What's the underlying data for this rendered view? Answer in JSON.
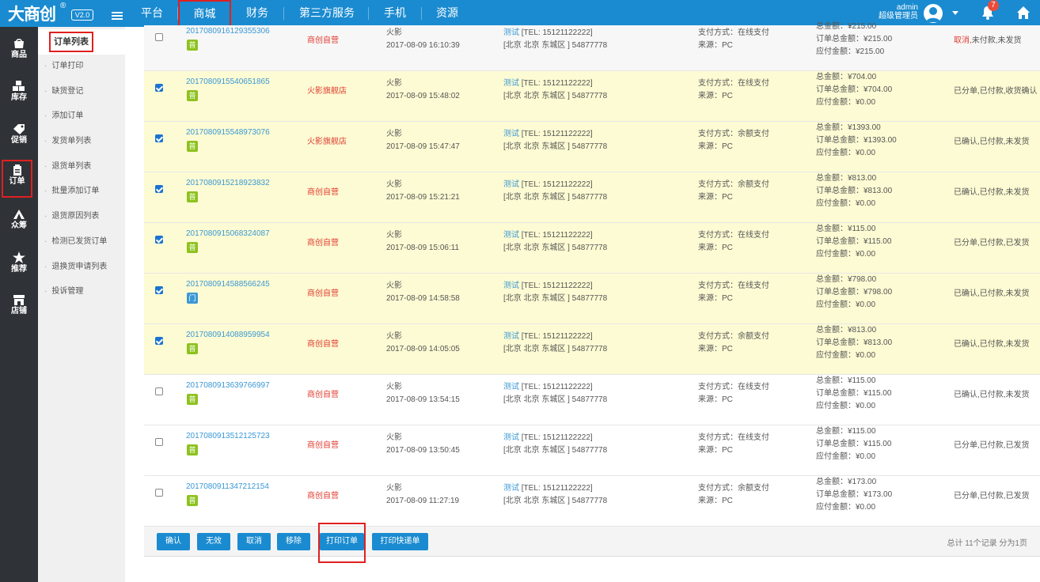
{
  "brand": {
    "logo": "大商创",
    "reg": "®",
    "version": "V2.0"
  },
  "nav": [
    "平台",
    "商城",
    "财务",
    "第三方服务",
    "手机",
    "资源"
  ],
  "user": {
    "name": "admin",
    "role": "超级管理员",
    "notifications": "7"
  },
  "sidebar": [
    "商品",
    "库存",
    "促销",
    "订单",
    "众筹",
    "推荐",
    "店铺"
  ],
  "submenu": {
    "title": "订单列表",
    "items": [
      "订单打印",
      "缺货登记",
      "添加订单",
      "发货单列表",
      "退货单列表",
      "批量添加订单",
      "退货原因列表",
      "检测已发货订单",
      "退换货申请列表",
      "投诉管理"
    ]
  },
  "orders": [
    {
      "no": "2017080916129355306",
      "tag": "普",
      "shop": "商创自营",
      "buyer": "火影",
      "time": "2017-08-09 16:10:39",
      "recv_name": "测试",
      "recv_tel": "[TEL: 15121122222]",
      "recv_addr": "[北京 北京 东城区 ] 54877778",
      "pay": "支付方式：在线支付",
      "src": "来源：PC",
      "total": "总金额：¥215.00",
      "order_total": "订单总金额：¥215.00",
      "due": "应付金额：¥215.00",
      "status_red": "取消,",
      "status": "未付款,未发货"
    },
    {
      "no": "2017080915540651865",
      "tag": "普",
      "shop": "火影旗舰店",
      "buyer": "火影",
      "time": "2017-08-09 15:48:02",
      "recv_name": "测试",
      "recv_tel": "[TEL: 15121122222]",
      "recv_addr": "[北京 北京 东城区 ] 54877778",
      "pay": "支付方式：在线支付",
      "src": "来源：PC",
      "total": "总金额：¥704.00",
      "order_total": "订单总金额：¥704.00",
      "due": "应付金额：¥0.00",
      "status_red": "",
      "status": "已分单,已付款,收货确认"
    },
    {
      "no": "2017080915548973076",
      "tag": "普",
      "shop": "火影旗舰店",
      "buyer": "火影",
      "time": "2017-08-09 15:47:47",
      "recv_name": "测试",
      "recv_tel": "[TEL: 15121122222]",
      "recv_addr": "[北京 北京 东城区 ] 54877778",
      "pay": "支付方式：余额支付",
      "src": "来源：PC",
      "total": "总金额：¥1393.00",
      "order_total": "订单总金额：¥1393.00",
      "due": "应付金额：¥0.00",
      "status_red": "",
      "status": "已确认,已付款,未发货"
    },
    {
      "no": "2017080915218923832",
      "tag": "普",
      "shop": "商创自营",
      "buyer": "火影",
      "time": "2017-08-09 15:21:21",
      "recv_name": "测试",
      "recv_tel": "[TEL: 15121122222]",
      "recv_addr": "[北京 北京 东城区 ] 54877778",
      "pay": "支付方式：余额支付",
      "src": "来源：PC",
      "total": "总金额：¥813.00",
      "order_total": "订单总金额：¥813.00",
      "due": "应付金额：¥0.00",
      "status_red": "",
      "status": "已确认,已付款,未发货"
    },
    {
      "no": "2017080915068324087",
      "tag": "普",
      "shop": "商创自营",
      "buyer": "火影",
      "time": "2017-08-09 15:06:11",
      "recv_name": "测试",
      "recv_tel": "[TEL: 15121122222]",
      "recv_addr": "[北京 北京 东城区 ] 54877778",
      "pay": "支付方式：在线支付",
      "src": "来源：PC",
      "total": "总金额：¥115.00",
      "order_total": "订单总金额：¥115.00",
      "due": "应付金额：¥0.00",
      "status_red": "",
      "status": "已分单,已付款,已发货"
    },
    {
      "no": "2017080914588566245",
      "tag": "门",
      "shop": "商创自营",
      "buyer": "火影",
      "time": "2017-08-09 14:58:58",
      "recv_name": "测试",
      "recv_tel": "[TEL: 15121122222]",
      "recv_addr": "[北京 北京 东城区 ] 54877778",
      "pay": "支付方式：在线支付",
      "src": "来源：PC",
      "total": "总金额：¥798.00",
      "order_total": "订单总金额：¥798.00",
      "due": "应付金额：¥0.00",
      "status_red": "",
      "status": "已确认,已付款,未发货"
    },
    {
      "no": "2017080914088959954",
      "tag": "普",
      "shop": "商创自营",
      "buyer": "火影",
      "time": "2017-08-09 14:05:05",
      "recv_name": "测试",
      "recv_tel": "[TEL: 15121122222]",
      "recv_addr": "[北京 北京 东城区 ] 54877778",
      "pay": "支付方式：余额支付",
      "src": "来源：PC",
      "total": "总金额：¥813.00",
      "order_total": "订单总金额：¥813.00",
      "due": "应付金额：¥0.00",
      "status_red": "",
      "status": "已确认,已付款,未发货"
    },
    {
      "no": "2017080913639766997",
      "tag": "普",
      "shop": "商创自营",
      "buyer": "火影",
      "time": "2017-08-09 13:54:15",
      "recv_name": "测试",
      "recv_tel": "[TEL: 15121122222]",
      "recv_addr": "[北京 北京 东城区 ] 54877778",
      "pay": "支付方式：在线支付",
      "src": "来源：PC",
      "total": "总金额：¥115.00",
      "order_total": "订单总金额：¥115.00",
      "due": "应付金额：¥0.00",
      "status_red": "",
      "status": "已确认,已付款,未发货"
    },
    {
      "no": "2017080913512125723",
      "tag": "普",
      "shop": "商创自营",
      "buyer": "火影",
      "time": "2017-08-09 13:50:45",
      "recv_name": "测试",
      "recv_tel": "[TEL: 15121122222]",
      "recv_addr": "[北京 北京 东城区 ] 54877778",
      "pay": "支付方式：在线支付",
      "src": "来源：PC",
      "total": "总金额：¥115.00",
      "order_total": "订单总金额：¥115.00",
      "due": "应付金额：¥0.00",
      "status_red": "",
      "status": "已分单,已付款,已发货"
    },
    {
      "no": "2017080911347212154",
      "tag": "普",
      "shop": "商创自营",
      "buyer": "火影",
      "time": "2017-08-09 11:27:19",
      "recv_name": "测试",
      "recv_tel": "[TEL: 15121122222]",
      "recv_addr": "[北京 北京 东城区 ] 54877778",
      "pay": "支付方式：余额支付",
      "src": "来源：PC",
      "total": "总金额：¥173.00",
      "order_total": "订单总金额：¥173.00",
      "due": "应付金额：¥0.00",
      "status_red": "",
      "status": "已分单,已付款,已发货"
    }
  ],
  "buttons": {
    "confirm": "确认",
    "invalid": "无效",
    "cancel": "取消",
    "remove": "移除",
    "print_order": "打印订单",
    "print_express": "打印快递单"
  },
  "pager": "总计 11个记录 分为1页",
  "colors": {
    "topbar": "#1a8bd0",
    "sidebar": "#2f3237",
    "highlight_row": "#fdfbd3",
    "link": "#3a98d5",
    "shop": "#e03c31"
  }
}
